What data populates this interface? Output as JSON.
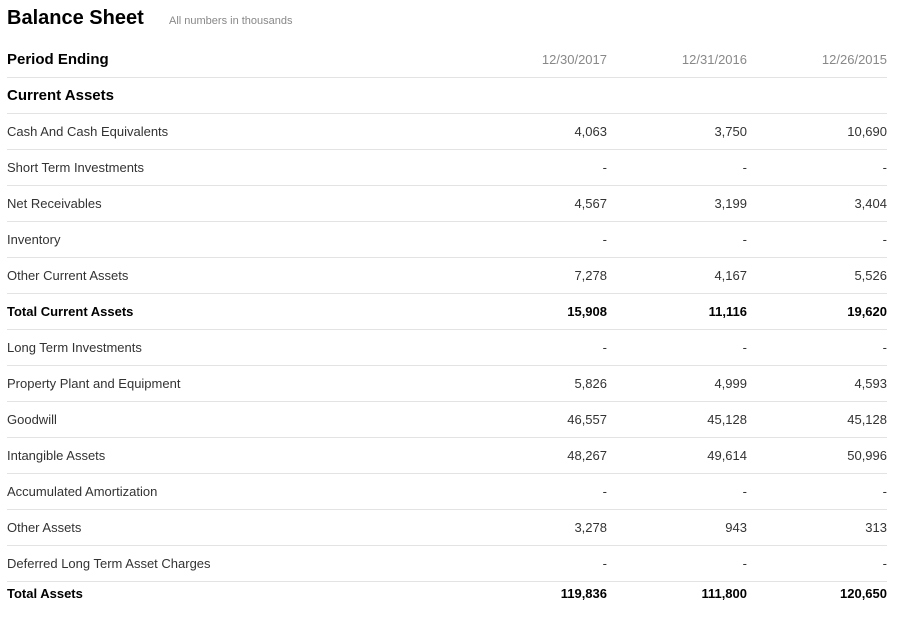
{
  "header": {
    "title": "Balance Sheet",
    "subtitle": "All numbers in thousands"
  },
  "table": {
    "period_label": "Period Ending",
    "dates": [
      "12/30/2017",
      "12/31/2016",
      "12/26/2015"
    ],
    "section_label": "Current Assets",
    "rows": [
      {
        "label": "Cash And Cash Equivalents",
        "values": [
          "4,063",
          "3,750",
          "10,690"
        ]
      },
      {
        "label": "Short Term Investments",
        "values": [
          "-",
          "-",
          "-"
        ]
      },
      {
        "label": "Net Receivables",
        "values": [
          "4,567",
          "3,199",
          "3,404"
        ]
      },
      {
        "label": "Inventory",
        "values": [
          "-",
          "-",
          "-"
        ]
      },
      {
        "label": "Other Current Assets",
        "values": [
          "7,278",
          "4,167",
          "5,526"
        ]
      },
      {
        "label": "Total Current Assets",
        "values": [
          "15,908",
          "11,116",
          "19,620"
        ]
      },
      {
        "label": "Long Term Investments",
        "values": [
          "-",
          "-",
          "-"
        ]
      },
      {
        "label": "Property Plant and Equipment",
        "values": [
          "5,826",
          "4,999",
          "4,593"
        ]
      },
      {
        "label": "Goodwill",
        "values": [
          "46,557",
          "45,128",
          "45,128"
        ]
      },
      {
        "label": "Intangible Assets",
        "values": [
          "48,267",
          "49,614",
          "50,996"
        ]
      },
      {
        "label": "Accumulated Amortization",
        "values": [
          "-",
          "-",
          "-"
        ]
      },
      {
        "label": "Other Assets",
        "values": [
          "3,278",
          "943",
          "313"
        ]
      },
      {
        "label": "Deferred Long Term Asset Charges",
        "values": [
          "-",
          "-",
          "-"
        ]
      },
      {
        "label": "Total Assets",
        "values": [
          "119,836",
          "111,800",
          "120,650"
        ]
      }
    ]
  }
}
